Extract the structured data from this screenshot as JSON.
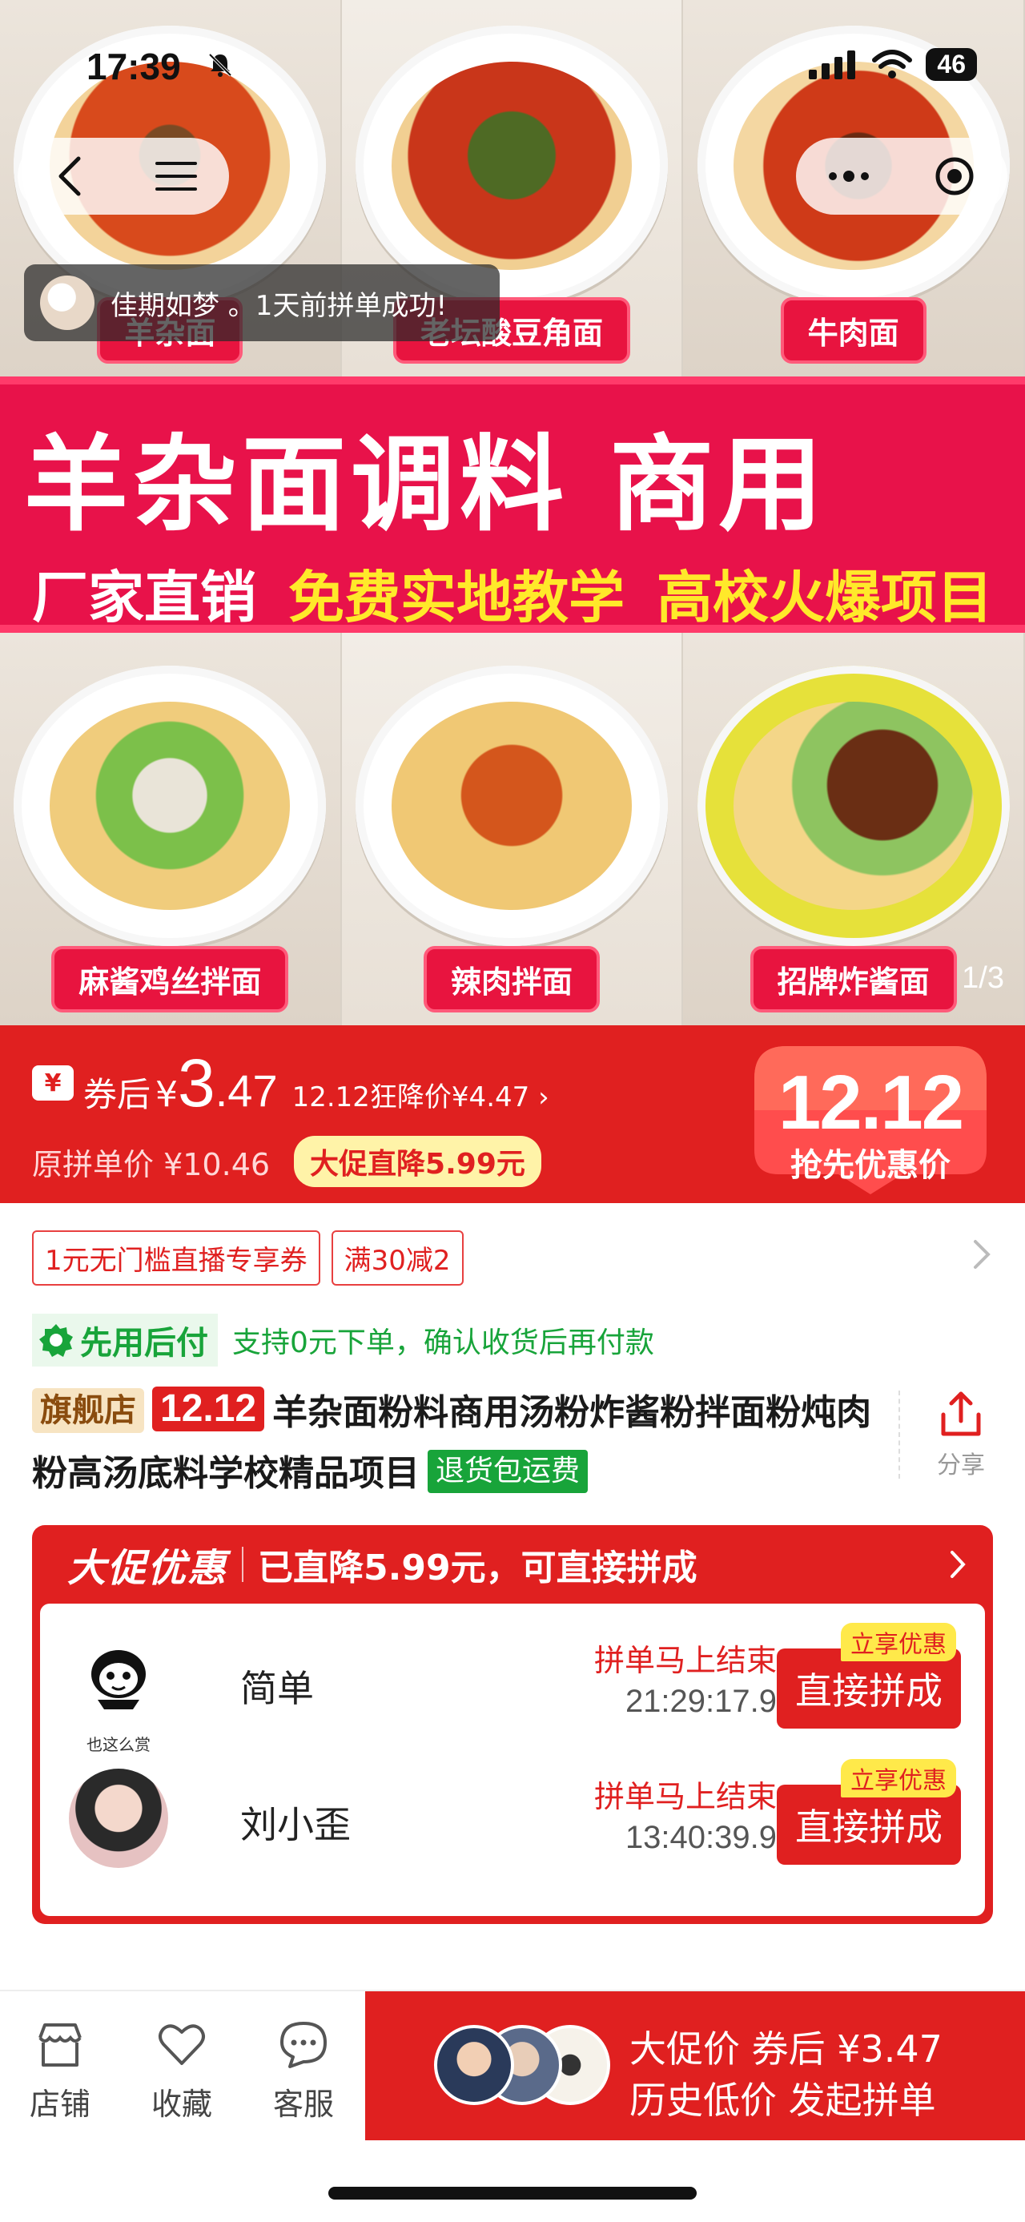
{
  "status_bar": {
    "time": "17:39",
    "battery": "46"
  },
  "hero": {
    "dishes_top": [
      "羊杂面",
      "老坛酸豆角面",
      "牛肉面"
    ],
    "dishes_bottom": [
      "麻酱鸡丝拌面",
      "辣肉拌面",
      "招牌炸酱面"
    ],
    "banner_title": "羊杂面调料  商用",
    "banner_sub_white": "厂家直销",
    "banner_sub_yellow_1": "免费实地教学",
    "banner_sub_yellow_2": "高校火爆项目",
    "image_counter": "1/3"
  },
  "toast": {
    "text": "佳期如梦 。1天前拼单成功!"
  },
  "price": {
    "coupon_icon": "¥",
    "after_coupon_label": "券后",
    "currency": "¥",
    "price_int": "3",
    "price_dec": ".47",
    "flash_price": "12.12狂降价¥4.47 ›",
    "original_price": "原拼单价 ¥10.46",
    "promo_tag": "大促直降5.99元",
    "badge_number": "12.12",
    "badge_text": "抢先优惠价"
  },
  "coupons": [
    "1元无门槛直播专享券",
    "满30减2"
  ],
  "pay_later": {
    "tag": "先用后付",
    "desc": "支持0元下单，确认收货后再付款"
  },
  "product": {
    "tag_flagship": "旗舰店",
    "tag_1212": "12.12",
    "title": "羊杂面粉料商用汤粉炸酱粉拌面粉炖肉粉高汤底料学校精品项目",
    "tag_return": "退货包运费",
    "share_label": "分享"
  },
  "group_buy": {
    "tag": "大促优惠",
    "message": "已直降5.99元，可直接拼成",
    "rows": [
      {
        "name": "简单",
        "avatar_caption": "也这么赏",
        "status": "拼单马上结束",
        "timer": "21:29:17.9",
        "button": "直接拼成",
        "button_tag": "立享优惠"
      },
      {
        "name": "刘小歪",
        "status": "拼单马上结束",
        "timer": "13:40:39.9",
        "button": "直接拼成",
        "button_tag": "立享优惠"
      }
    ]
  },
  "bottom_bar": {
    "store": "店铺",
    "favorite": "收藏",
    "service": "客服",
    "buy_line1": "大促价  券后 ¥3.47",
    "buy_line2": "历史低价  发起拼单"
  },
  "colors": {
    "accent": "#e02020",
    "green": "#18a43a",
    "banner": "#e8124a"
  }
}
